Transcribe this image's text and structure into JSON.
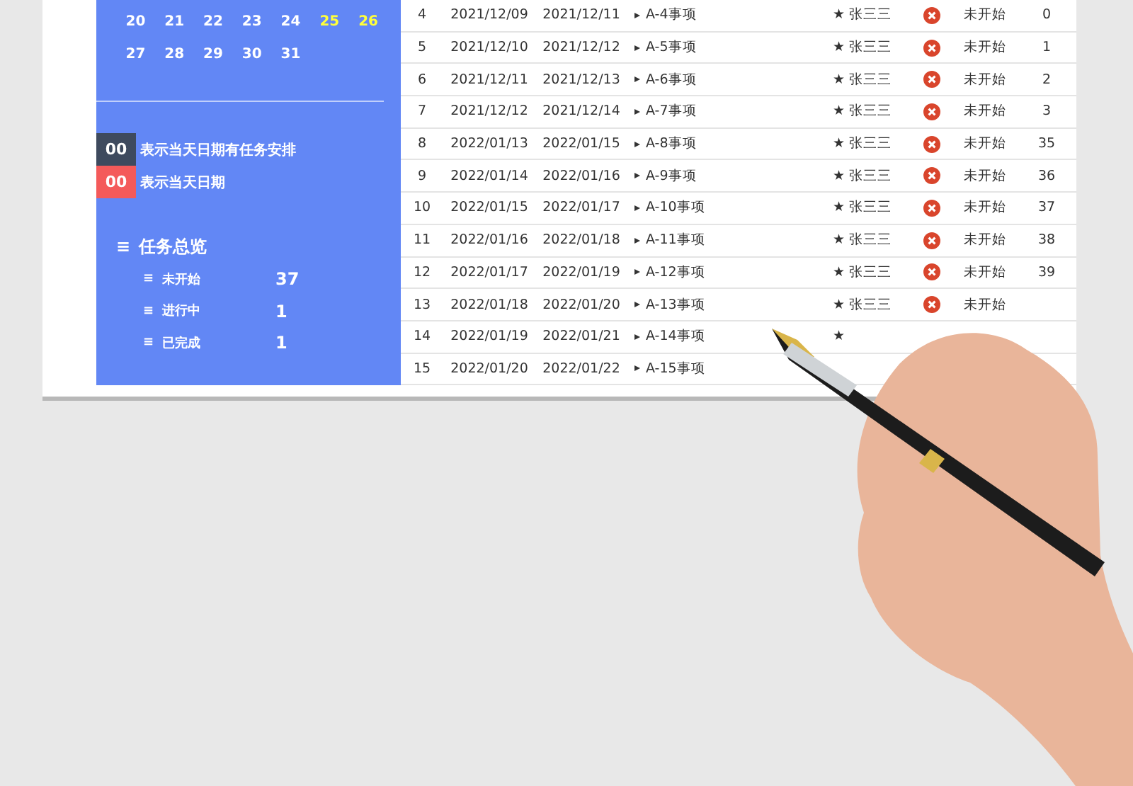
{
  "calendar": {
    "weeks": [
      [
        {
          "day": "20",
          "weekend": false
        },
        {
          "day": "21",
          "weekend": false
        },
        {
          "day": "22",
          "weekend": false
        },
        {
          "day": "23",
          "weekend": false
        },
        {
          "day": "24",
          "weekend": false
        },
        {
          "day": "25",
          "weekend": true
        },
        {
          "day": "26",
          "weekend": true
        }
      ],
      [
        {
          "day": "27",
          "weekend": false
        },
        {
          "day": "28",
          "weekend": false
        },
        {
          "day": "29",
          "weekend": false
        },
        {
          "day": "30",
          "weekend": false
        },
        {
          "day": "31",
          "weekend": false
        }
      ]
    ]
  },
  "legend": [
    {
      "code": "00",
      "text": "表示当天日期有任务安排",
      "color": "#3e4a5e"
    },
    {
      "code": "00",
      "text": "表示当天日期",
      "color": "#f45a5a"
    }
  ],
  "summary": {
    "icon": "≡",
    "title": "任务总览",
    "items": [
      {
        "icon": "≡",
        "label": "未开始",
        "count": "37"
      },
      {
        "icon": "≡",
        "label": "进行中",
        "count": "1"
      },
      {
        "icon": "≡",
        "label": "已完成",
        "count": "1"
      }
    ]
  },
  "table": {
    "rows": [
      {
        "no": "4",
        "start": "2021/12/09",
        "end": "2021/12/11",
        "item": "A-4事项",
        "owner": "★ 张三三",
        "status": "未开始",
        "count": "0"
      },
      {
        "no": "5",
        "start": "2021/12/10",
        "end": "2021/12/12",
        "item": "A-5事项",
        "owner": "★ 张三三",
        "status": "未开始",
        "count": "1"
      },
      {
        "no": "6",
        "start": "2021/12/11",
        "end": "2021/12/13",
        "item": "A-6事项",
        "owner": "★ 张三三",
        "status": "未开始",
        "count": "2"
      },
      {
        "no": "7",
        "start": "2021/12/12",
        "end": "2021/12/14",
        "item": "A-7事项",
        "owner": "★ 张三三",
        "status": "未开始",
        "count": "3"
      },
      {
        "no": "8",
        "start": "2022/01/13",
        "end": "2022/01/15",
        "item": "A-8事项",
        "owner": "★ 张三三",
        "status": "未开始",
        "count": "35"
      },
      {
        "no": "9",
        "start": "2022/01/14",
        "end": "2022/01/16",
        "item": "A-9事项",
        "owner": "★ 张三三",
        "status": "未开始",
        "count": "36"
      },
      {
        "no": "10",
        "start": "2022/01/15",
        "end": "2022/01/17",
        "item": "A-10事项",
        "owner": "★ 张三三",
        "status": "未开始",
        "count": "37"
      },
      {
        "no": "11",
        "start": "2022/01/16",
        "end": "2022/01/18",
        "item": "A-11事项",
        "owner": "★ 张三三",
        "status": "未开始",
        "count": "38"
      },
      {
        "no": "12",
        "start": "2022/01/17",
        "end": "2022/01/19",
        "item": "A-12事项",
        "owner": "★ 张三三",
        "status": "未开始",
        "count": "39"
      },
      {
        "no": "13",
        "start": "2022/01/18",
        "end": "2022/01/20",
        "item": "A-13事项",
        "owner": "★ 张三三",
        "status": "未开始"
      },
      {
        "no": "14",
        "start": "2022/01/19",
        "end": "2022/01/21",
        "item": "A-14事项",
        "owner": "★"
      },
      {
        "no": "15",
        "start": "2022/01/20",
        "end": "2022/01/22",
        "item": "A-15事项"
      }
    ]
  }
}
